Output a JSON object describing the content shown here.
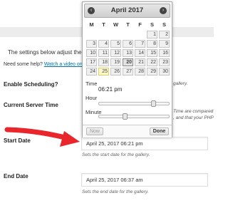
{
  "page": {
    "intro": "The settings below adjust the Sche",
    "help_prefix": "Need some help?",
    "help_link": "Watch a video on ho",
    "rows": {
      "scheduling_label": "Enable Scheduling?",
      "scheduling_frag": "gallery.",
      "server_time_label": "Current Server Time",
      "server_time_frag1": "Time are compared",
      "server_time_frag2": ", and that your PHP",
      "start_label": "Start Date",
      "start_value": "April 25, 2017 06:21 pm",
      "start_desc": "Sets the start date for the gallery.",
      "end_label": "End Date",
      "end_value": "April 25, 2017 06:37 am",
      "end_desc": "Sets the end date for the gallery."
    }
  },
  "datepicker": {
    "prev_icon": "‹",
    "next_icon": "›",
    "month_title": "April 2017",
    "weekdays": [
      "M",
      "T",
      "W",
      "T",
      "F",
      "S",
      "S"
    ],
    "weeks": [
      [
        "",
        "",
        "",
        "",
        "",
        "1",
        "2"
      ],
      [
        "3",
        "4",
        "5",
        "6",
        "7",
        "8",
        "9"
      ],
      [
        "10",
        "11",
        "12",
        "13",
        "14",
        "15",
        "16"
      ],
      [
        "17",
        "18",
        "19",
        "20",
        "21",
        "22",
        "23"
      ],
      [
        "24",
        "25",
        "26",
        "27",
        "28",
        "29",
        "30"
      ]
    ],
    "today": "25",
    "selected": "20",
    "time_label": "Time",
    "time_value": "06:21 pm",
    "hour_label": "Hour",
    "hour_level": 0.78,
    "minute_label": "Minute",
    "minute_level": 0.36,
    "now_button": "Now",
    "done_button": "Done"
  },
  "colors": {
    "accent_arrow": "#e8262b",
    "link": "#0073aa"
  }
}
